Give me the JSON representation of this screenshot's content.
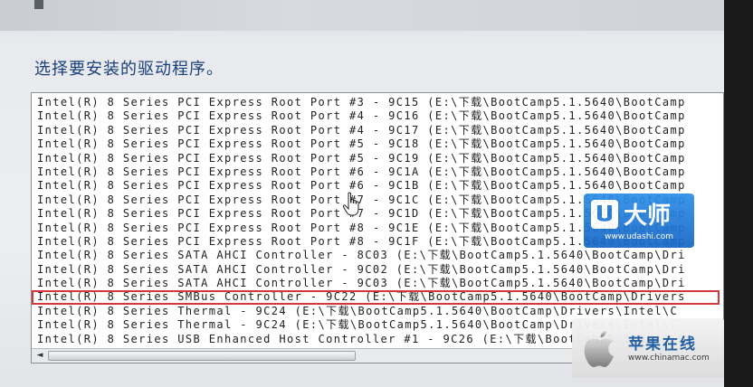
{
  "dialog": {
    "heading": "选择要安装的驱动程序。"
  },
  "driver_list": {
    "rows": [
      "Intel(R) 8 Series PCI Express Root Port #3 - 9C15 (E:\\下载\\BootCamp5.1.5640\\BootCamp",
      "Intel(R) 8 Series PCI Express Root Port #4 - 9C16 (E:\\下载\\BootCamp5.1.5640\\BootCamp",
      "Intel(R) 8 Series PCI Express Root Port #4 - 9C17 (E:\\下载\\BootCamp5.1.5640\\BootCamp",
      "Intel(R) 8 Series PCI Express Root Port #5 - 9C18 (E:\\下载\\BootCamp5.1.5640\\BootCamp",
      "Intel(R) 8 Series PCI Express Root Port #5 - 9C19 (E:\\下载\\BootCamp5.1.5640\\BootCamp",
      "Intel(R) 8 Series PCI Express Root Port #6 - 9C1A (E:\\下载\\BootCamp5.1.5640\\BootCamp",
      "Intel(R) 8 Series PCI Express Root Port #6 - 9C1B (E:\\下载\\BootCamp5.1.5640\\BootCamp",
      "Intel(R) 8 Series PCI Express Root Port #7 - 9C1C (E:\\下载\\BootCamp5.1.5640\\BootCamp",
      "Intel(R) 8 Series PCI Express Root Port #7 - 9C1D (E:\\下载\\BootCamp5.1.5640\\BootCamp",
      "Intel(R) 8 Series PCI Express Root Port #8 - 9C1E (E:\\下载\\BootCamp5.1.5640\\BootCamp",
      "Intel(R) 8 Series PCI Express Root Port #8 - 9C1F (E:\\下载\\BootCamp5.1.5640\\BootCamp",
      "Intel(R) 8 Series SATA AHCI Controller - 8C03 (E:\\下载\\BootCamp5.1.5640\\BootCamp\\Dri",
      "Intel(R) 8 Series SATA AHCI Controller - 9C02 (E:\\下载\\BootCamp5.1.5640\\BootCamp\\Dri",
      "Intel(R) 8 Series SATA AHCI Controller - 9C03 (E:\\下载\\BootCamp5.1.5640\\BootCamp\\Dri",
      "Intel(R) 8 Series SMBus Controller - 9C22 (E:\\下载\\BootCamp5.1.5640\\BootCamp\\Drivers",
      "Intel(R) 8 Series Thermal - 9C24 (E:\\下载\\BootCamp5.1.5640\\BootCamp\\Drivers\\Intel\\C",
      "Intel(R) 8 Series Thermal - 9C24 (E:\\下载\\BootCamp5.1.5640\\BootCamp\\Drivers\\Intel\\C",
      "Intel(R) 8 Series USB Enhanced Host Controller #1 - 9C26 (E:\\下载\\BootCamp5.1.5640\\Bo"
    ],
    "selected_index": 14,
    "scroll_left_arrow": "◄"
  },
  "watermarks": {
    "udashi": {
      "logo_text": "U大师",
      "url": "www.udashi.com"
    },
    "chinamac": {
      "name": "苹果在线",
      "url": "www.chinamac.com"
    }
  },
  "colors": {
    "heading": "#1a3f7a",
    "selection_outline": "#d4383e",
    "udashi_blue": "#1f78d6"
  },
  "icons": {
    "cursor": "hand-pointer-icon",
    "udashi_logo": "udashi-logo-icon",
    "chinamac_logo": "apple-logo-icon"
  }
}
